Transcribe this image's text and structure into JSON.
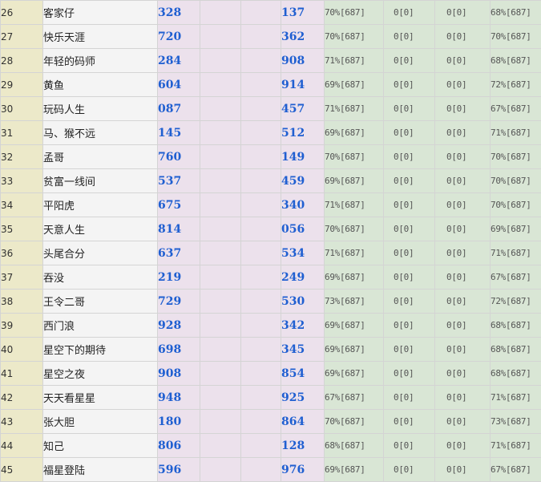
{
  "rows": [
    {
      "rank": "26",
      "name": "客家仔",
      "v1": "328",
      "v2": "137",
      "p1": "70%[687]",
      "z1": "0[0]",
      "z2": "0[0]",
      "p2": "68%[687]"
    },
    {
      "rank": "27",
      "name": "快乐天涯",
      "v1": "720",
      "v2": "362",
      "p1": "70%[687]",
      "z1": "0[0]",
      "z2": "0[0]",
      "p2": "70%[687]"
    },
    {
      "rank": "28",
      "name": "年轻的码师",
      "v1": "284",
      "v2": "908",
      "p1": "71%[687]",
      "z1": "0[0]",
      "z2": "0[0]",
      "p2": "68%[687]"
    },
    {
      "rank": "29",
      "name": "黄鱼",
      "v1": "604",
      "v2": "914",
      "p1": "69%[687]",
      "z1": "0[0]",
      "z2": "0[0]",
      "p2": "72%[687]"
    },
    {
      "rank": "30",
      "name": "玩码人生",
      "v1": "087",
      "v2": "457",
      "p1": "71%[687]",
      "z1": "0[0]",
      "z2": "0[0]",
      "p2": "67%[687]"
    },
    {
      "rank": "31",
      "name": "马、猴不远",
      "v1": "145",
      "v2": "512",
      "p1": "69%[687]",
      "z1": "0[0]",
      "z2": "0[0]",
      "p2": "71%[687]"
    },
    {
      "rank": "32",
      "name": "孟哥",
      "v1": "760",
      "v2": "149",
      "p1": "70%[687]",
      "z1": "0[0]",
      "z2": "0[0]",
      "p2": "70%[687]"
    },
    {
      "rank": "33",
      "name": "贫富一线间",
      "v1": "537",
      "v2": "459",
      "p1": "69%[687]",
      "z1": "0[0]",
      "z2": "0[0]",
      "p2": "70%[687]"
    },
    {
      "rank": "34",
      "name": "平阳虎",
      "v1": "675",
      "v2": "340",
      "p1": "71%[687]",
      "z1": "0[0]",
      "z2": "0[0]",
      "p2": "70%[687]"
    },
    {
      "rank": "35",
      "name": "天意人生",
      "v1": "814",
      "v2": "056",
      "p1": "70%[687]",
      "z1": "0[0]",
      "z2": "0[0]",
      "p2": "69%[687]"
    },
    {
      "rank": "36",
      "name": "头尾合分",
      "v1": "637",
      "v2": "534",
      "p1": "71%[687]",
      "z1": "0[0]",
      "z2": "0[0]",
      "p2": "71%[687]"
    },
    {
      "rank": "37",
      "name": "吞没",
      "v1": "219",
      "v2": "249",
      "p1": "69%[687]",
      "z1": "0[0]",
      "z2": "0[0]",
      "p2": "67%[687]"
    },
    {
      "rank": "38",
      "name": "王令二哥",
      "v1": "729",
      "v2": "530",
      "p1": "73%[687]",
      "z1": "0[0]",
      "z2": "0[0]",
      "p2": "72%[687]"
    },
    {
      "rank": "39",
      "name": "西门浪",
      "v1": "928",
      "v2": "342",
      "p1": "69%[687]",
      "z1": "0[0]",
      "z2": "0[0]",
      "p2": "68%[687]"
    },
    {
      "rank": "40",
      "name": "星空下的期待",
      "v1": "698",
      "v2": "345",
      "p1": "69%[687]",
      "z1": "0[0]",
      "z2": "0[0]",
      "p2": "68%[687]"
    },
    {
      "rank": "41",
      "name": "星空之夜",
      "v1": "908",
      "v2": "854",
      "p1": "69%[687]",
      "z1": "0[0]",
      "z2": "0[0]",
      "p2": "68%[687]"
    },
    {
      "rank": "42",
      "name": "天天看星星",
      "v1": "948",
      "v2": "925",
      "p1": "67%[687]",
      "z1": "0[0]",
      "z2": "0[0]",
      "p2": "71%[687]"
    },
    {
      "rank": "43",
      "name": "张大胆",
      "v1": "180",
      "v2": "864",
      "p1": "70%[687]",
      "z1": "0[0]",
      "z2": "0[0]",
      "p2": "73%[687]"
    },
    {
      "rank": "44",
      "name": "知己",
      "v1": "806",
      "v2": "128",
      "p1": "68%[687]",
      "z1": "0[0]",
      "z2": "0[0]",
      "p2": "71%[687]"
    },
    {
      "rank": "45",
      "name": "福星登陆",
      "v1": "596",
      "v2": "976",
      "p1": "69%[687]",
      "z1": "0[0]",
      "z2": "0[0]",
      "p2": "67%[687]"
    }
  ]
}
